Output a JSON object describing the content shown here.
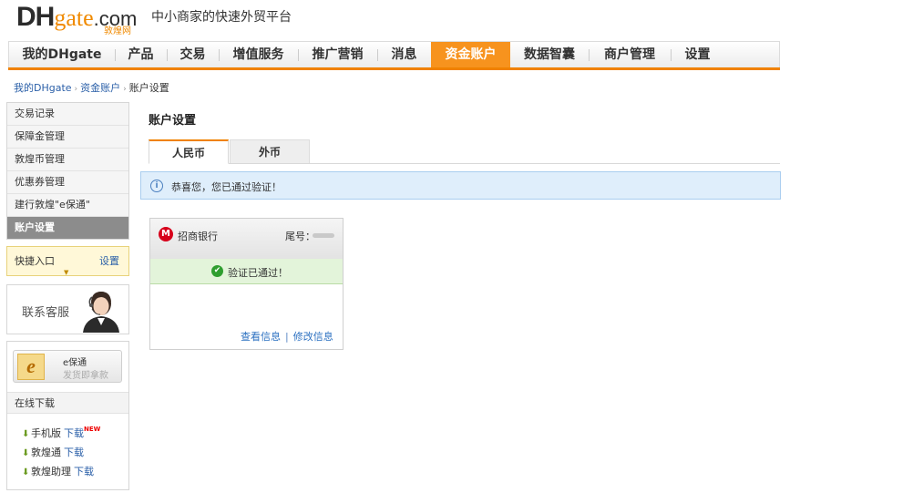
{
  "header": {
    "logo_dh": "DH",
    "logo_gate": "gate",
    "logo_com": ".com",
    "logo_sub": "敦煌网",
    "slogan": "中小商家的快速外贸平台"
  },
  "nav": {
    "items": [
      {
        "label": "我的DHgate"
      },
      {
        "label": "产品"
      },
      {
        "label": "交易"
      },
      {
        "label": "增值服务"
      },
      {
        "label": "推广营销"
      },
      {
        "label": "消息"
      },
      {
        "label": "资金账户"
      },
      {
        "label": "数据智囊"
      },
      {
        "label": "商户管理"
      },
      {
        "label": "设置"
      }
    ],
    "active_index": 6
  },
  "breadcrumb": {
    "items": [
      "我的DHgate",
      "资金账户",
      "账户设置"
    ],
    "separator": "›"
  },
  "sidebar": {
    "items": [
      {
        "label": "交易记录"
      },
      {
        "label": "保障金管理"
      },
      {
        "label": "敦煌币管理"
      },
      {
        "label": "优惠券管理"
      },
      {
        "label": "建行敦煌\"e保通\""
      },
      {
        "label": "账户设置"
      }
    ],
    "active_index": 5,
    "quick": {
      "title": "快捷入口",
      "settings": "设置"
    },
    "customer_service": "联系客服",
    "ebaotong": {
      "icon_letter": "e",
      "name": "e保通",
      "hint": "发货即拿款"
    },
    "downloads": {
      "title": "在线下载",
      "items": [
        {
          "name": "手机版",
          "link": "下载",
          "badge": "NEW"
        },
        {
          "name": "敦煌通",
          "link": "下载"
        },
        {
          "name": "敦煌助理",
          "link": "下载"
        }
      ]
    }
  },
  "main": {
    "title": "账户设置",
    "tabs": [
      {
        "label": "人民币"
      },
      {
        "label": "外币"
      }
    ],
    "active_tab": 0,
    "notice": "恭喜您，您已通过验证！",
    "card": {
      "bank_name": "招商银行",
      "tail_label": "尾号：",
      "verified_text": "验证已通过！",
      "view_link": "查看信息",
      "separator": "|",
      "edit_link": "修改信息"
    }
  },
  "colors": {
    "accent": "#f7931e",
    "link": "#2a5fa8",
    "verified": "#2f9e2f",
    "notice_bg": "#dfeefb"
  }
}
